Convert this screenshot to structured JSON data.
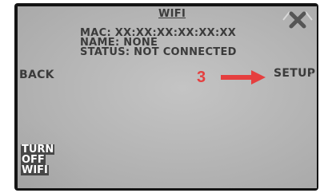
{
  "screen": {
    "title": "WIFI",
    "mac_line": "MAC: XX:XX:XX:XX:XX:XX",
    "name_line": "NAME: NONE",
    "status_line": "STATUS: NOT CONNECTED",
    "back_label": "BACK",
    "setup_label": "SETUP",
    "setup_chevron": "›",
    "turn_off_lines": [
      "TURN",
      "OFF",
      "WIFI"
    ],
    "close_icon": "close-icon"
  },
  "annotation": {
    "step_number": "3",
    "arrow_color": "#e53f3f"
  }
}
